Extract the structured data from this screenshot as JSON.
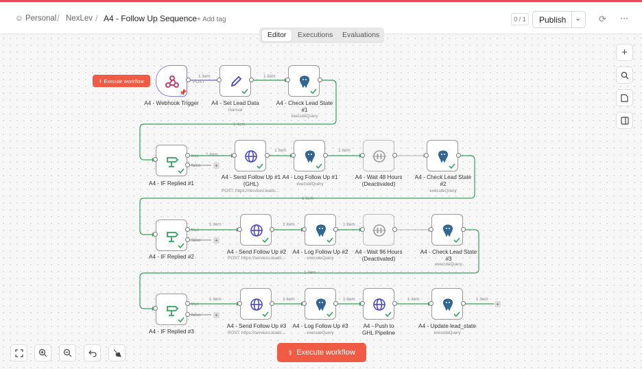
{
  "header": {
    "breadcrumb": {
      "personal": "Personal",
      "project": "NexLev",
      "workflow": "A4 - Follow Up Sequence"
    },
    "add_tag": "+ Add tag",
    "version_counter": "0 / 1",
    "publish_label": "Publish"
  },
  "tabs": [
    "Editor",
    "Executions",
    "Evaluations"
  ],
  "execute_small_label": "Execute workflow",
  "execute_main_label": "Execute workflow",
  "nodes": [
    {
      "id": "webhook",
      "label": "A4 - Webhook Trigger",
      "sub": "",
      "icon": "webhook-icon"
    },
    {
      "id": "setlead",
      "label": "A4 - Set Lead Data",
      "sub": "manual",
      "icon": "pencil-icon"
    },
    {
      "id": "check1",
      "label": "A4 - Check Lead State #1",
      "sub": "executeQuery",
      "icon": "postgres-icon"
    },
    {
      "id": "if1",
      "label": "A4 - IF Replied #1",
      "sub": "",
      "icon": "if-icon"
    },
    {
      "id": "send1",
      "label": "A4 - Send Follow Up #1 (GHL)",
      "sub": "POST: https://services.leadc...",
      "icon": "globe-icon"
    },
    {
      "id": "log1",
      "label": "A4 - Log Follow Up #1",
      "sub": "executeQuery",
      "icon": "postgres-icon"
    },
    {
      "id": "wait48",
      "label": "A4 - Wait 48 Hours (Deactivated)",
      "sub": "",
      "icon": "pause-icon"
    },
    {
      "id": "check2",
      "label": "A4 - Check Lead State #2",
      "sub": "executeQuery",
      "icon": "postgres-icon"
    },
    {
      "id": "if2",
      "label": "A4 - IF Replied #2",
      "sub": "",
      "icon": "if-icon"
    },
    {
      "id": "send2",
      "label": "A4 - Send Follow Up #2",
      "sub": "POST: https://services.leadc...",
      "icon": "globe-icon"
    },
    {
      "id": "log2",
      "label": "A4 - Log Follow Up #2",
      "sub": "executeQuery",
      "icon": "postgres-icon"
    },
    {
      "id": "wait96",
      "label": "A4 - Wait 96 Hours (Deactivated)",
      "sub": "",
      "icon": "pause-icon"
    },
    {
      "id": "check3",
      "label": "A4 - Check Lead State #3",
      "sub": "executeQuery",
      "icon": "postgres-icon"
    },
    {
      "id": "if3",
      "label": "A4 - IF Replied #3",
      "sub": "",
      "icon": "if-icon"
    },
    {
      "id": "send3",
      "label": "A4 - Send Follow Up #3",
      "sub": "POST: https://services.leadc...",
      "icon": "globe-icon"
    },
    {
      "id": "log3",
      "label": "A4 - Log Follow Up #3",
      "sub": "executeQuery",
      "icon": "postgres-icon"
    },
    {
      "id": "push",
      "label": "A4 - Push to GHL Pipeline",
      "sub": "",
      "icon": "globe-icon"
    },
    {
      "id": "update",
      "label": "A4 - Update lead_state",
      "sub": "executeQuery",
      "icon": "postgres-icon"
    }
  ],
  "edge_labels": {
    "item": "1 item",
    "post": "POST",
    "true": "true",
    "false": "false"
  },
  "colors": {
    "accent": "#ef5b45",
    "success": "#2fa35a",
    "trigger": "#8d7fd8",
    "postgres": "#336791",
    "globe": "#4b46c8"
  }
}
